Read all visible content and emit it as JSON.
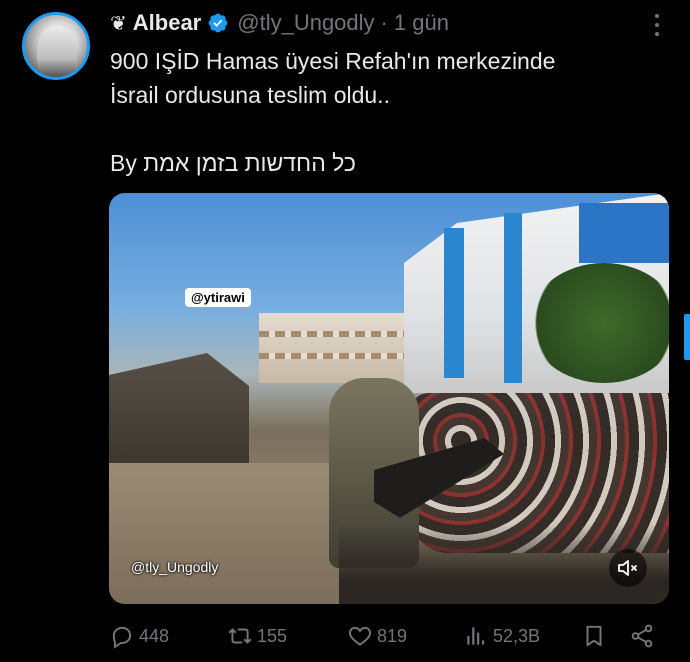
{
  "author": {
    "emoji": "❦",
    "display_name": "Albear",
    "handle": "@tly_Ungodly",
    "separator": "·",
    "time": "1 gün"
  },
  "tweet": {
    "line1": "900 IŞİD Hamas üyesi Refah'ın merkezinde",
    "line2": "İsrail ordusuna teslim oldu..",
    "line3": "By כל החדשות בזמן אמת"
  },
  "media": {
    "watermark_top": "@ytirawi",
    "watermark_bottom": "@tly_Ungodly"
  },
  "actions": {
    "replies": "448",
    "reposts": "155",
    "likes": "819",
    "views": "52,3B"
  },
  "colors": {
    "accent": "#1d9bf0",
    "muted": "#71767b",
    "text": "#e7e9ea",
    "background": "#000000"
  },
  "icons": [
    "verified-badge-icon",
    "more-icon",
    "mute-icon",
    "reply-icon",
    "repost-icon",
    "like-icon",
    "views-icon",
    "bookmark-icon",
    "share-icon"
  ]
}
